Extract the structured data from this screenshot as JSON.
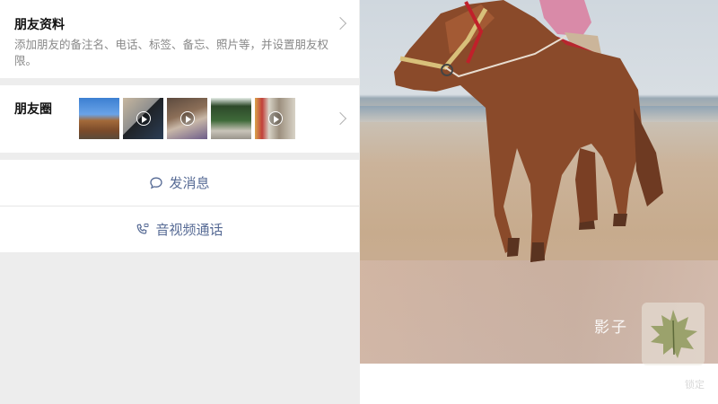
{
  "profile": {
    "title": "朋友资料",
    "description": "添加朋友的备注名、电话、标签、备忘、照片等，并设置朋友权限。"
  },
  "moments": {
    "title": "朋友圈",
    "thumbnails": [
      {
        "kind": "photo"
      },
      {
        "kind": "video"
      },
      {
        "kind": "video"
      },
      {
        "kind": "photo"
      },
      {
        "kind": "video"
      }
    ]
  },
  "actions": {
    "message_label": "发消息",
    "call_label": "音视频通话"
  },
  "photo": {
    "watermark_text": "影子",
    "watermark_sub": "锁定"
  },
  "colors": {
    "link": "#576b95",
    "background": "#ededed",
    "card": "#ffffff"
  }
}
